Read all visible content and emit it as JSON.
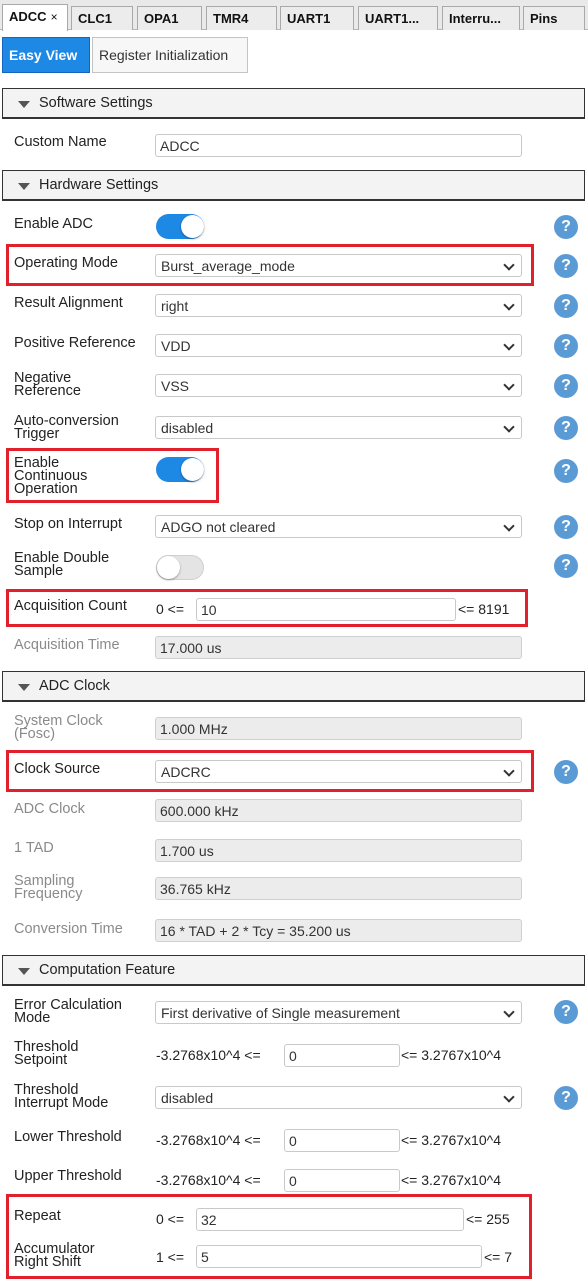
{
  "tabs": {
    "adcc": "ADCC",
    "close": "×",
    "clc1": "CLC1",
    "opa1": "OPA1",
    "tmr4": "TMR4",
    "uart1": "UART1",
    "uart1b": "UART1...",
    "interrupt": "Interru...",
    "pins": "Pins"
  },
  "subtabs": {
    "easy_view": "Easy View",
    "register_init": "Register Initialization"
  },
  "software": {
    "header": "Software Settings",
    "custom_name_label": "Custom Name",
    "custom_name_value": "ADCC"
  },
  "hardware": {
    "header": "Hardware Settings",
    "enable_adc_label": "Enable ADC",
    "operating_mode_label": "Operating Mode",
    "operating_mode_value": "Burst_average_mode",
    "result_alignment_label": "Result Alignment",
    "result_alignment_value": "right",
    "positive_ref_label": "Positive Reference",
    "positive_ref_value": "VDD",
    "negative_ref_label_1": "Negative",
    "negative_ref_label_2": "Reference",
    "negative_ref_value": "VSS",
    "auto_conv_label_1": "Auto-conversion",
    "auto_conv_label_2": "Trigger",
    "auto_conv_value": "disabled",
    "cont_op_label_1": "Enable",
    "cont_op_label_2": "Continuous",
    "cont_op_label_3": "Operation",
    "stop_interrupt_label": "Stop on Interrupt",
    "stop_interrupt_value": "ADGO not cleared",
    "double_sample_label_1": "Enable Double",
    "double_sample_label_2": "Sample",
    "acq_count_label": "Acquisition Count",
    "acq_count_min": "0 <=",
    "acq_count_value": "10",
    "acq_count_max": "<= 8191",
    "acq_time_label": "Acquisition Time",
    "acq_time_value": "17.000 us"
  },
  "clock": {
    "header": "ADC Clock",
    "sys_clock_label_1": "System Clock",
    "sys_clock_label_2": "(Fosc)",
    "sys_clock_value": "1.000 MHz",
    "clock_source_label": "Clock Source",
    "clock_source_value": "ADCRC",
    "adc_clock_label": "ADC Clock",
    "adc_clock_value": "600.000 kHz",
    "tad_label": "1 TAD",
    "tad_value": "1.700 us",
    "sampling_label_1": "Sampling",
    "sampling_label_2": "Frequency",
    "sampling_value": "36.765 kHz",
    "conv_time_label": "Conversion Time",
    "conv_time_value": "16 * TAD + 2 * Tcy = 35.200 us"
  },
  "computation": {
    "header": "Computation Feature",
    "err_calc_label_1": "Error Calculation",
    "err_calc_label_2": "Mode",
    "err_calc_value": "First derivative of Single measurement",
    "thr_setpoint_label_1": "Threshold",
    "thr_setpoint_label_2": "Setpoint",
    "thr_min": "-3.2768x10^4 <=",
    "thr_max": "<= 3.2767x10^4",
    "thr_setpoint_value": "0",
    "thr_int_label_1": "Threshold",
    "thr_int_label_2": "Interrupt Mode",
    "thr_int_value": "disabled",
    "lower_thr_label": "Lower Threshold",
    "lower_thr_value": "0",
    "upper_thr_label": "Upper Threshold",
    "upper_thr_value": "0",
    "repeat_label": "Repeat",
    "repeat_min": "0 <=",
    "repeat_value": "32",
    "repeat_max": "<= 255",
    "acc_shift_label_1": "Accumulator",
    "acc_shift_label_2": "Right Shift",
    "acc_shift_min": "1 <=",
    "acc_shift_value": "5",
    "acc_shift_max": "<= 7"
  },
  "toggles": {
    "enable_adc": true,
    "continuous_operation": true,
    "double_sample": false
  },
  "help_glyph": "?",
  "colors": {
    "accent": "#1e88e5",
    "highlight": "#e0202a",
    "help": "#5b9bd5"
  }
}
